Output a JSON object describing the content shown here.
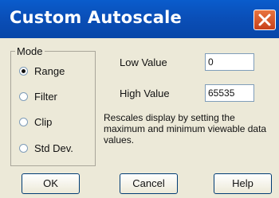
{
  "dialog": {
    "title": "Custom Autoscale",
    "close_icon": "close-icon",
    "titlebar_color": "#0a4fb8",
    "close_color": "#d9552a"
  },
  "mode": {
    "legend": "Mode",
    "options": [
      {
        "label": "Range",
        "selected": true
      },
      {
        "label": "Filter",
        "selected": false
      },
      {
        "label": "Clip",
        "selected": false
      },
      {
        "label": "Std Dev.",
        "selected": false
      }
    ]
  },
  "fields": {
    "low_label": "Low Value",
    "low_value": "0",
    "high_label": "High Value",
    "high_value": "65535"
  },
  "description": "Rescales display by setting the maximum and minimum viewable data values.",
  "buttons": {
    "ok": "OK",
    "cancel": "Cancel",
    "help": "Help"
  }
}
